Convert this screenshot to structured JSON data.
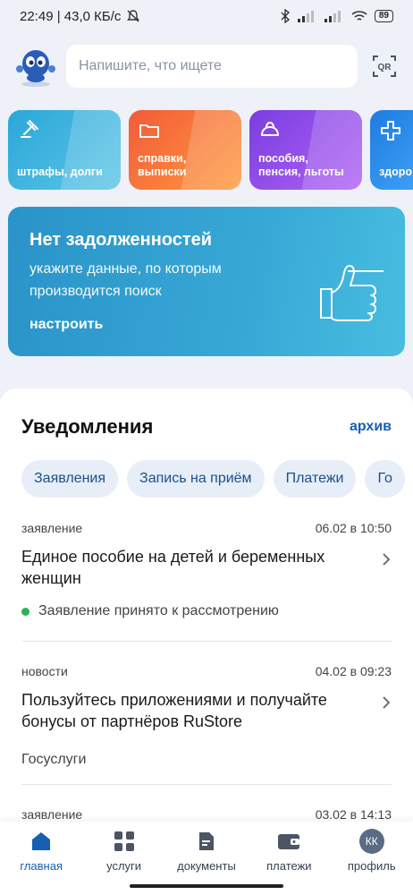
{
  "status_bar": {
    "time_speed": "22:49 | 43,0 КБ/с",
    "battery": "89"
  },
  "header": {
    "search_placeholder": "Напишите, что ищете",
    "qr_label": "QR"
  },
  "categories": [
    {
      "label_line1": "штрафы, долги",
      "label_line2": "",
      "icon": "gavel-icon"
    },
    {
      "label_line1": "справки,",
      "label_line2": "выписки",
      "icon": "folder-icon"
    },
    {
      "label_line1": "пособия,",
      "label_line2": "пенсия, льготы",
      "icon": "wallet-icon"
    },
    {
      "label_line1": "здоро",
      "label_line2": "",
      "icon": "cross-icon"
    }
  ],
  "debt": {
    "title": "Нет задолженностей",
    "subtitle": "укажите данные, по которым производится поиск",
    "link": "настроить"
  },
  "notifications": {
    "title": "Уведомления",
    "archive": "архив",
    "chips": [
      "Заявления",
      "Запись на приём",
      "Платежи",
      "Го"
    ],
    "items": [
      {
        "type": "заявление",
        "date": "06.02 в 10:50",
        "title": "Единое пособие на детей и беременных женщин",
        "status": "Заявление принято к рассмотрению"
      },
      {
        "type": "новости",
        "date": "04.02 в 09:23",
        "title": "Пользуйтесь приложениями и получайте бонусы от партнёров RuStore",
        "source": "Госуслуги"
      },
      {
        "type": "заявление",
        "date": "03.02 в 14:13"
      }
    ]
  },
  "nav": [
    {
      "label": "главная",
      "icon": "home-icon"
    },
    {
      "label": "услуги",
      "icon": "grid-icon"
    },
    {
      "label": "документы",
      "icon": "document-icon"
    },
    {
      "label": "платежи",
      "icon": "wallet-icon"
    },
    {
      "label": "профиль",
      "avatar": "КК"
    }
  ],
  "colors": {
    "accent": "#1660b4",
    "status_green": "#29b35a"
  }
}
